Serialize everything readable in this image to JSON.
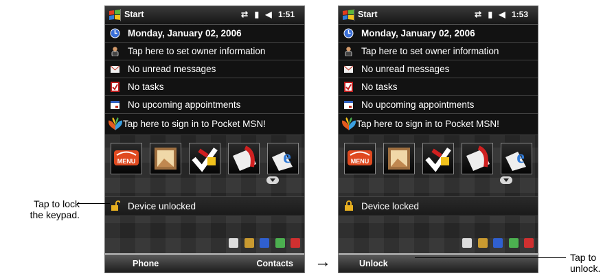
{
  "screens": [
    {
      "start_label": "Start",
      "time": "1:51",
      "date": "Monday, January 02, 2006",
      "rows": [
        "Tap here to set owner information",
        "No unread messages",
        "No tasks",
        "No upcoming appointments",
        "Tap here to sign in to Pocket MSN!"
      ],
      "tile_menu_label": "MENU",
      "lock_status": "Device unlocked",
      "soft_left": "Phone",
      "soft_right": "Contacts"
    },
    {
      "start_label": "Start",
      "time": "1:53",
      "date": "Monday, January 02, 2006",
      "rows": [
        "Tap here to set owner information",
        "No unread messages",
        "No tasks",
        "No upcoming appointments",
        "Tap here to sign in to Pocket MSN!"
      ],
      "tile_menu_label": "MENU",
      "lock_status": "Device locked",
      "soft_left": "Unlock",
      "soft_right": ""
    }
  ],
  "annotations": {
    "left_line1": "Tap to lock",
    "left_line2": "the keypad.",
    "right_line1": "Tap to",
    "right_line2": "unlock.",
    "arrow": "→"
  },
  "icons": [
    "windows-logo-icon",
    "connectivity-icon",
    "signal-icon",
    "volume-icon",
    "calendar-icon",
    "owner-icon",
    "messages-icon",
    "tasks-icon",
    "appointments-icon",
    "msn-butterfly-icon",
    "lock-icon"
  ],
  "colors": {
    "screen_bg": "#121212",
    "text": "#ffffff",
    "lock_icon": "#e8b020"
  }
}
